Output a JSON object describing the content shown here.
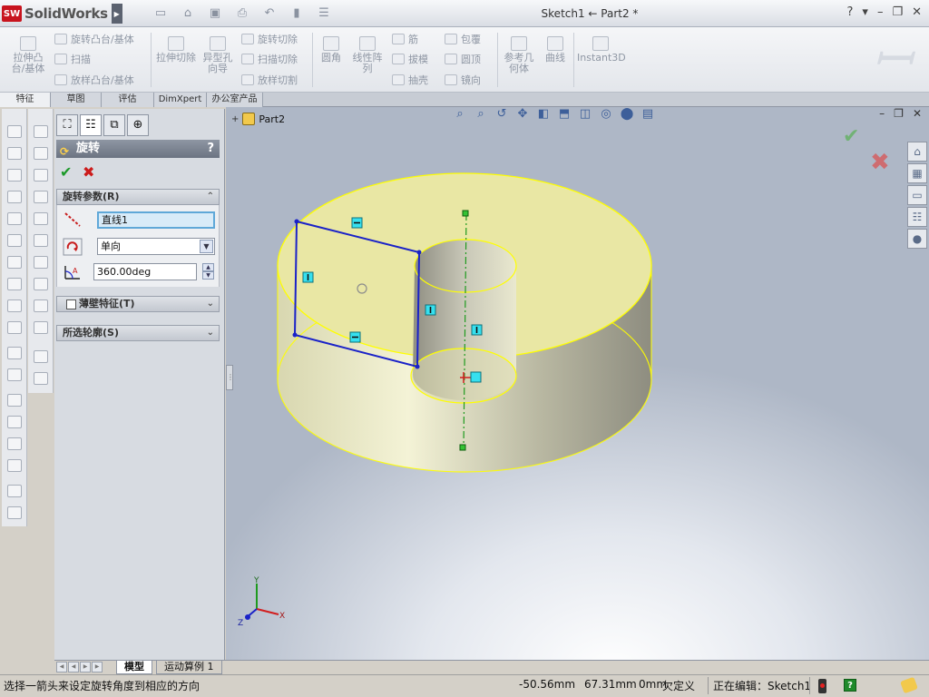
{
  "app": {
    "name": "SolidWorks",
    "logo_badge": "SW",
    "window_title": "Sketch1 ← Part2 *"
  },
  "ribbon": {
    "extrude_boss": "拉伸凸台/基体",
    "revolve_boss": "旋转凸台/基体",
    "sweep": "扫描",
    "loft_boss": "放样凸台/基体",
    "extrude_cut": "拉伸切除",
    "hole_wizard": "异型孔向导",
    "revolve_cut": "旋转切除",
    "swept_cut": "扫描切除",
    "lofted_cut": "放样切割",
    "fillet": "圆角",
    "linear_pattern": "线性阵列",
    "rib": "筋",
    "draft": "拔模",
    "shell": "抽壳",
    "wrap": "包覆",
    "dome": "圆顶",
    "mirror": "镜向",
    "ref_geometry": "参考几何体",
    "curves": "曲线",
    "instant3d": "Instant3D"
  },
  "cm_tabs": [
    "特征",
    "草图",
    "评估",
    "DimXpert",
    "办公室产品"
  ],
  "property_manager": {
    "title": "旋转",
    "help": "?",
    "revolve_params_header": "旋转参数(R)",
    "axis_value": "直线1",
    "direction_value": "单向",
    "angle_value": "360.00deg",
    "thin_feature_header": "薄壁特征(T)",
    "selected_contours_header": "所选轮廓(S)"
  },
  "graphics": {
    "tree_root": "Part2",
    "triad": {
      "x": "X",
      "y": "Y",
      "z": "Z"
    }
  },
  "bottom_tabs": [
    "模型",
    "运动算例 1"
  ],
  "status": {
    "message": "选择一箭头来设定旋转角度到相应的方向",
    "x": "-50.56mm",
    "y": "67.31mm",
    "z": "0mm",
    "definition": "欠定义",
    "editing": "正在编辑：Sketch1"
  },
  "colors": {
    "model_face": "#e9e7a4",
    "model_edge": "#ffff00",
    "sketch_line": "#1a22c8",
    "axis_line": "#1e9a1e",
    "accent_red": "#c8141e"
  }
}
